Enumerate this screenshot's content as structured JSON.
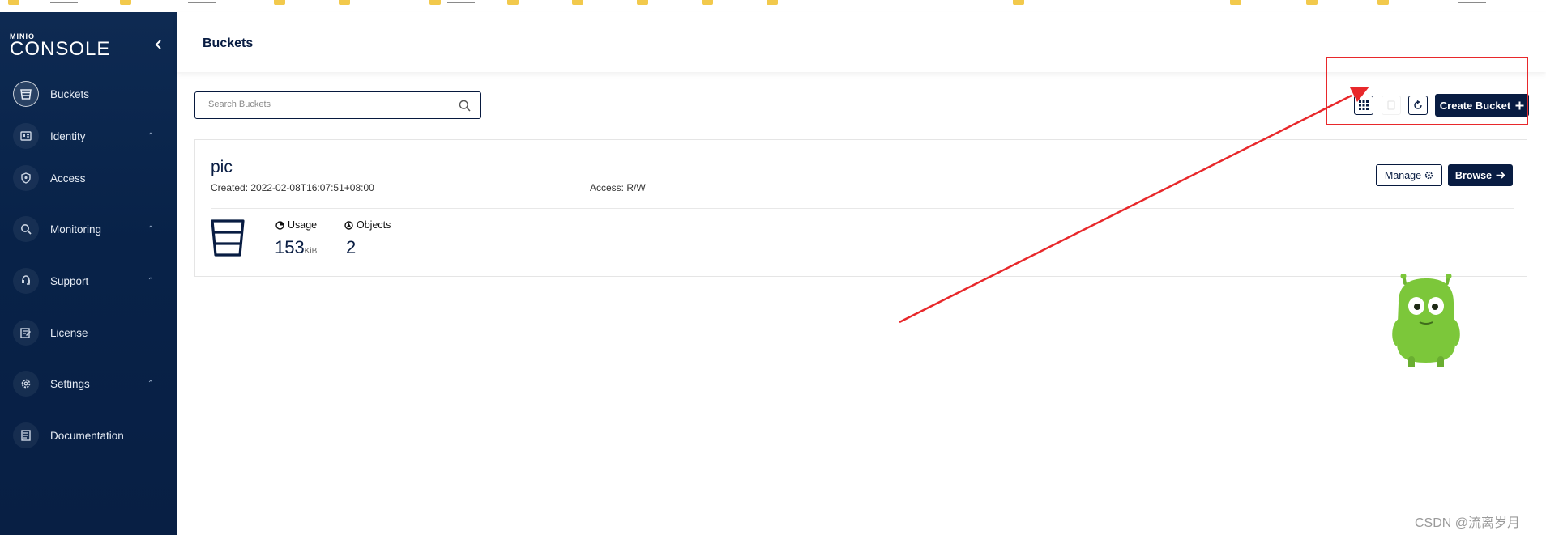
{
  "app": {
    "logo_small": "MINIO",
    "logo_large": "CONSOLE"
  },
  "sidebar": {
    "items": [
      {
        "label": "Buckets",
        "icon": "bucket-icon",
        "active": true,
        "expandable": false
      },
      {
        "label": "Identity",
        "icon": "id-card-icon",
        "active": false,
        "expandable": true
      },
      {
        "label": "Access",
        "icon": "shield-icon",
        "active": false,
        "expandable": false
      },
      {
        "label": "Monitoring",
        "icon": "search-icon",
        "active": false,
        "expandable": true
      },
      {
        "label": "Support",
        "icon": "support-icon",
        "active": false,
        "expandable": true
      },
      {
        "label": "License",
        "icon": "license-icon",
        "active": false,
        "expandable": false
      },
      {
        "label": "Settings",
        "icon": "gear-icon",
        "active": false,
        "expandable": true
      },
      {
        "label": "Documentation",
        "icon": "document-icon",
        "active": false,
        "expandable": false
      }
    ]
  },
  "header": {
    "title": "Buckets"
  },
  "toolbar": {
    "search_placeholder": "Search Buckets",
    "create_label": "Create Bucket"
  },
  "bucket": {
    "name": "pic",
    "created": "Created: 2022-02-08T16:07:51+08:00",
    "access": "Access: R/W",
    "manage_label": "Manage",
    "browse_label": "Browse",
    "usage_label": "Usage",
    "usage_value": "153",
    "usage_unit": "KiB",
    "objects_label": "Objects",
    "objects_value": "2"
  },
  "watermark": "CSDN @流离岁月",
  "colors": {
    "sidebar": "#0b2650",
    "primary": "#081c42",
    "annotation": "#e8282b",
    "mascot": "#7cc73a"
  }
}
